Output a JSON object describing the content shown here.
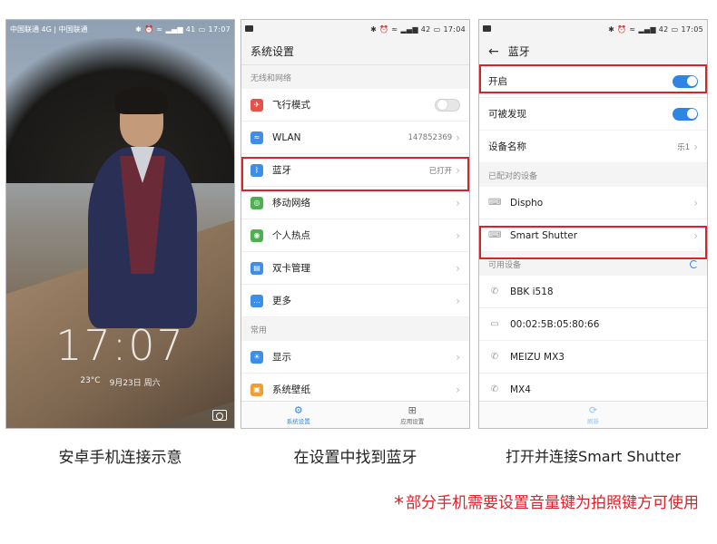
{
  "phone1": {
    "status_left": "中国联通 4G | 中国联通",
    "status_right": "41",
    "status_time": "17:07",
    "lock_time": "17:07",
    "weather": "23°C",
    "date": "9月23日 周六"
  },
  "phone2": {
    "status_right": "42",
    "status_time": "17:04",
    "title": "系统设置",
    "section_network": "无线和网络",
    "items": [
      {
        "label": "飞行模式",
        "value": "",
        "color": "#e8504a",
        "glyph": "✈"
      },
      {
        "label": "WLAN",
        "value": "147852369",
        "color": "#3c8ee8",
        "glyph": "≈"
      },
      {
        "label": "蓝牙",
        "value": "已打开",
        "color": "#3c8ee8",
        "glyph": "ᛒ"
      },
      {
        "label": "移动网络",
        "value": "",
        "color": "#4caf50",
        "glyph": "◎"
      },
      {
        "label": "个人热点",
        "value": "",
        "color": "#4caf50",
        "glyph": "◉"
      },
      {
        "label": "双卡管理",
        "value": "",
        "color": "#3c8ee8",
        "glyph": "▤"
      },
      {
        "label": "更多",
        "value": "",
        "color": "#3c8ee8",
        "glyph": "…"
      }
    ],
    "section_common": "常用",
    "common_items": [
      {
        "label": "显示",
        "color": "#3c8ee8",
        "glyph": "☀"
      },
      {
        "label": "系统壁纸",
        "color": "#f39c33",
        "glyph": "▣"
      }
    ],
    "nav": {
      "left": "系统设置",
      "right": "应用设置"
    }
  },
  "phone3": {
    "status_right": "42",
    "status_time": "17:05",
    "title": "蓝牙",
    "enable_label": "开启",
    "discoverable_label": "可被发现",
    "device_name_label": "设备名称",
    "device_name_value": "乐1",
    "paired_header": "已配对的设备",
    "paired": [
      "Dispho",
      "Smart Shutter"
    ],
    "available_header": "可用设备",
    "available": [
      {
        "name": "BBK i518",
        "type": "phone"
      },
      {
        "name": "00:02:5B:05:80:66",
        "type": "laptop"
      },
      {
        "name": "MEIZU MX3",
        "type": "phone"
      },
      {
        "name": "MX4",
        "type": "phone"
      }
    ],
    "nav_refresh": "刷新"
  },
  "captions": {
    "c1": "安卓手机连接示意",
    "c2": "在设置中找到蓝牙",
    "c3": "打开并连接Smart Shutter"
  },
  "footnote": "部分手机需要设置音量键为拍照键方可使用",
  "star": "*",
  "colors": {
    "accent": "#2f86e2",
    "highlight": "#d8232a"
  }
}
